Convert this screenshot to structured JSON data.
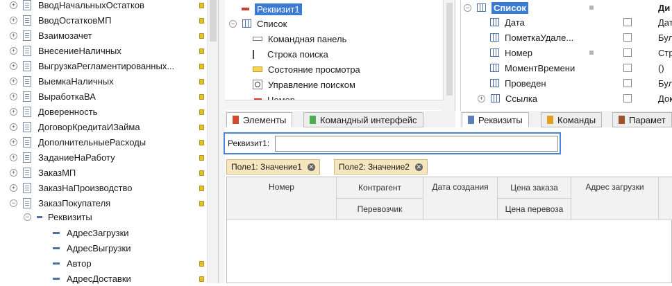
{
  "left_tree": {
    "items": [
      {
        "label": "ВводНачальныхОстатков",
        "expander": "+"
      },
      {
        "label": "ВводОстатковМП",
        "expander": "+"
      },
      {
        "label": "Взаимозачет",
        "expander": "+"
      },
      {
        "label": "ВнесениеНаличных",
        "expander": "+"
      },
      {
        "label": "ВыгрузкаРегламентированных...",
        "expander": "+"
      },
      {
        "label": "ВыемкаНаличных",
        "expander": "+"
      },
      {
        "label": "ВыработкаВА",
        "expander": "+"
      },
      {
        "label": "Доверенность",
        "expander": "+"
      },
      {
        "label": "ДоговорКредитаИЗайма",
        "expander": "+"
      },
      {
        "label": "ДополнительныеРасходы",
        "expander": "+"
      },
      {
        "label": "ЗаданиеНаРаботу",
        "expander": "+"
      },
      {
        "label": "ЗаказМП",
        "expander": "+"
      },
      {
        "label": "ЗаказНаПроизводство",
        "expander": "+"
      },
      {
        "label": "ЗаказПокупателя",
        "expander": "−"
      }
    ],
    "requisites_node": {
      "label": "Реквизиты",
      "expander": "−"
    },
    "requisites": [
      {
        "label": "АдресЗагрузки"
      },
      {
        "label": "АдресВыгрузки"
      },
      {
        "label": "Автор"
      },
      {
        "label": "АдресДоставки"
      }
    ]
  },
  "form_tree": {
    "selected_item": "Реквизит1",
    "list_node": {
      "label": "Список",
      "expander": "−"
    },
    "children": [
      {
        "label": "Командная панель",
        "icon": "command-bar-icon"
      },
      {
        "label": "Строка поиска",
        "icon": "search-string-icon"
      },
      {
        "label": "Состояние просмотра",
        "icon": "view-state-icon"
      },
      {
        "label": "Управление поиском",
        "icon": "search-control-icon"
      },
      {
        "label": "Номер",
        "icon": "field-icon"
      }
    ]
  },
  "attributes_pane": {
    "root": {
      "label": "Список",
      "expander": "−"
    },
    "header_right": "Ди",
    "rows": [
      {
        "name": "Дата",
        "type": "Дат"
      },
      {
        "name": "ПометкаУдале...",
        "type": "Бул"
      },
      {
        "name": "Номер",
        "type": "Стр"
      },
      {
        "name": "МоментВремени",
        "type": "()"
      },
      {
        "name": "Проведен",
        "type": "Бул"
      },
      {
        "name": "Ссылка",
        "type": "Док",
        "expander": "+"
      }
    ]
  },
  "tabs_left": [
    {
      "label": "Элементы",
      "color": "#d44a2e",
      "active": true
    },
    {
      "label": "Командный интерфейс",
      "color": "#4caf50",
      "active": false
    }
  ],
  "tabs_right": [
    {
      "label": "Реквизиты",
      "color": "#5b7fb8",
      "active": true
    },
    {
      "label": "Команды",
      "color": "#e0a020",
      "active": false
    },
    {
      "label": "Парамет",
      "color": "#a0522d",
      "active": false
    }
  ],
  "preview": {
    "field_label": "Реквизит1:",
    "field_value": "",
    "filters": [
      {
        "label": "Поле1: Значение1"
      },
      {
        "label": "Поле2: Значение2"
      }
    ],
    "columns": {
      "number": "Номер",
      "counterparty": "Контрагент",
      "carrier": "Перевозчик",
      "created": "Дата создания",
      "order_price": "Цена заказа",
      "transport_price": "Цена перевоза",
      "load_address": "Адрес загрузки"
    }
  }
}
